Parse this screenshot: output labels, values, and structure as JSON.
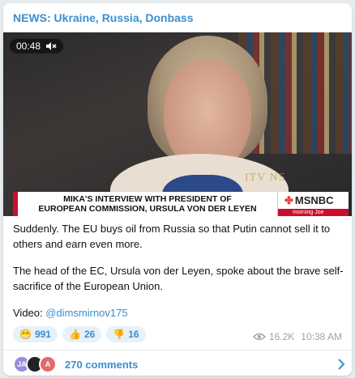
{
  "channel": {
    "name": "NEWS: Ukraine, Russia, Donbass"
  },
  "video": {
    "duration": "00:48",
    "mute_icon": "muted-speaker-icon",
    "watermark": "ITV NS",
    "lower_third": {
      "line1": "MIKA'S INTERVIEW WITH PRESIDENT OF",
      "line2": "EUROPEAN COMMISSION, URSULA VON DER LEYEN",
      "network": "MSNBC",
      "show": "morning Joe"
    }
  },
  "post": {
    "paragraph1": "Suddenly. The EU buys oil from Russia so that Putin cannot sell it to others and earn even more.",
    "paragraph2": "The head of the EC, Ursula von der Leyen, spoke about the brave self-sacrifice of the European Union.",
    "video_label": "Video: ",
    "video_link": "@dimsmirnov175"
  },
  "reactions": [
    {
      "emoji": "😁",
      "count": "991"
    },
    {
      "emoji": "👍",
      "count": "26"
    },
    {
      "emoji": "👎",
      "count": "16"
    }
  ],
  "meta": {
    "views": "16.2K",
    "time": "10:38 AM"
  },
  "comments": {
    "avatars": [
      "JA",
      "",
      "A"
    ],
    "avatar_colors": [
      "#9b8be0",
      "#222222",
      "#e46a6a"
    ],
    "label": "270 comments"
  },
  "colors": {
    "accent": "#3a8fcf",
    "msnbc_red": "#c8102e"
  }
}
